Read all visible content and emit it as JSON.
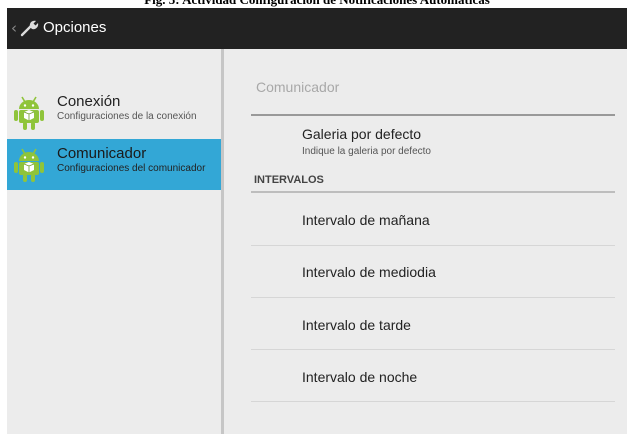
{
  "caption": "Fig. 5: Actividad Configuración de Notificaciones Automáticas",
  "action_bar": {
    "title": "Opciones",
    "up_icon": "up-caret-icon",
    "app_icon": "wrench-icon",
    "background": "#222222"
  },
  "headers": [
    {
      "title": "Conexión",
      "summary": "Configuraciones de la conexión",
      "icon": "android-icon",
      "selected": false
    },
    {
      "title": "Comunicador",
      "summary": "Configuraciones del comunicador",
      "icon": "android-icon",
      "selected": true
    }
  ],
  "selected_color": "#33a7d6",
  "detail": {
    "category": "Comunicador",
    "gallery": {
      "title": "Galeria por defecto",
      "summary": "Indique la galeria por defecto"
    },
    "section_header": "INTERVALOS",
    "intervals": [
      "Intervalo de mañana",
      "Intervalo de mediodia",
      "Intervalo de tarde",
      "Intervalo de noche"
    ]
  }
}
